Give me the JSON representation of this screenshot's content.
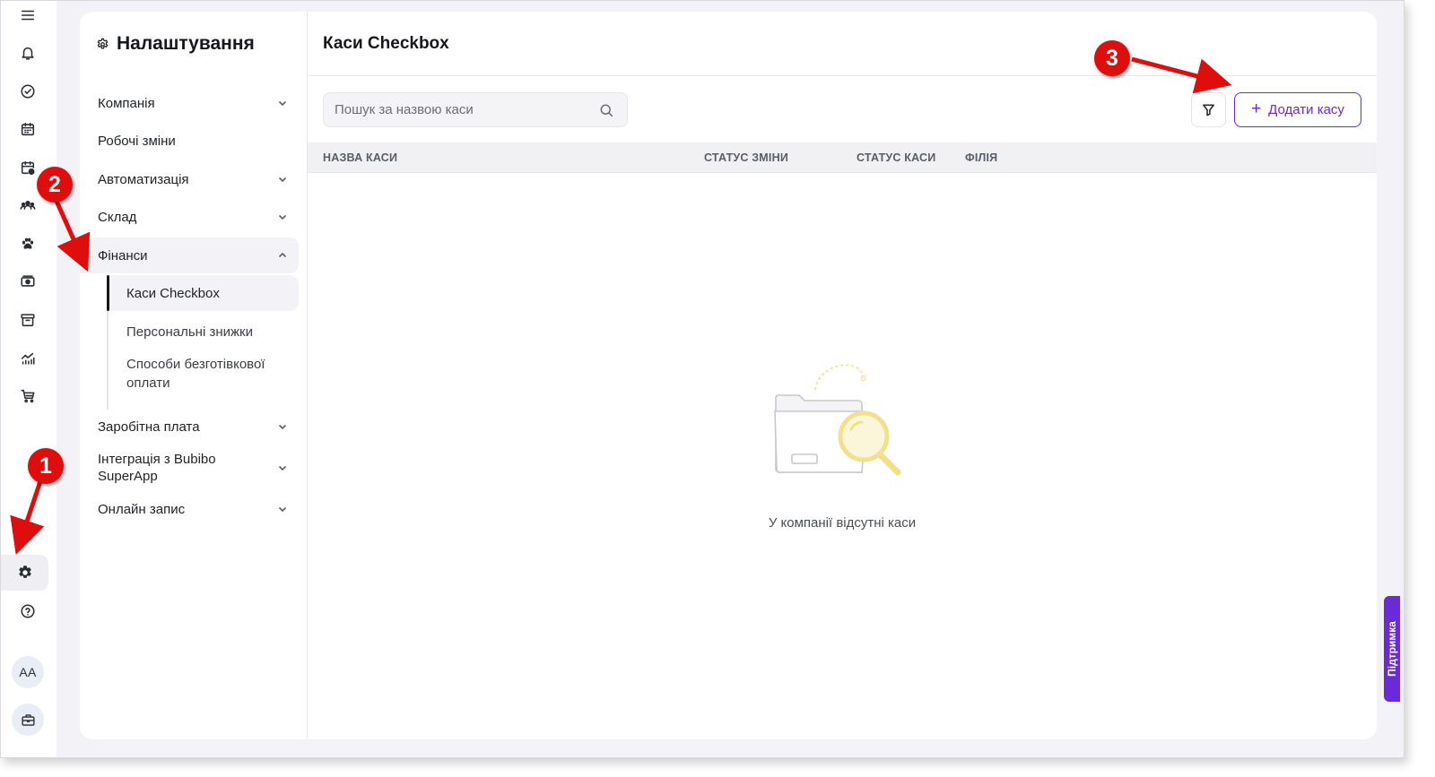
{
  "rail": {
    "items": [
      {
        "name": "menu-icon"
      },
      {
        "name": "bell-icon"
      },
      {
        "name": "check-circle-icon"
      },
      {
        "name": "calendar-icon"
      },
      {
        "name": "calendar-clock-icon"
      },
      {
        "name": "users-icon"
      },
      {
        "name": "paw-icon"
      },
      {
        "name": "money-icon"
      },
      {
        "name": "archive-icon"
      },
      {
        "name": "analytics-icon"
      },
      {
        "name": "cart-icon"
      },
      {
        "name": "gear-icon",
        "active": true
      },
      {
        "name": "help-icon"
      }
    ],
    "avatar_initials": "AA"
  },
  "settings": {
    "title": "Налаштування",
    "nav": [
      {
        "label": "Компанія",
        "expandable": true
      },
      {
        "label": "Робочі зміни",
        "expandable": false
      },
      {
        "label": "Автоматизація",
        "expandable": true
      },
      {
        "label": "Склад",
        "expandable": true
      },
      {
        "label": "Фінанси",
        "expandable": true,
        "open": true
      },
      {
        "label": "Заробітна плата",
        "expandable": true
      },
      {
        "label": "Інтеграція з Bubibo SuperApp",
        "expandable": true
      },
      {
        "label": "Онлайн запис",
        "expandable": true
      }
    ],
    "finance_sub": [
      {
        "label": "Каси Checkbox",
        "active": true
      },
      {
        "label": "Персональні знижки"
      },
      {
        "label": "Способи безготівкової оплати"
      }
    ]
  },
  "main": {
    "title": "Каси Checkbox",
    "search_placeholder": "Пошук за назвою каси",
    "add_button": "Додати касу",
    "columns": [
      "НАЗВА КАСИ",
      "СТАТУС ЗМІНИ",
      "СТАТУС КАСИ",
      "ФІЛІЯ"
    ],
    "empty_message": "У компанії відсутні каси"
  },
  "support_label": "Підтримка",
  "markers": [
    "1",
    "2",
    "3"
  ],
  "colors": {
    "accent": "#6b2ad8",
    "marker": "#e00d0d",
    "illustration": "#f3e08a"
  }
}
